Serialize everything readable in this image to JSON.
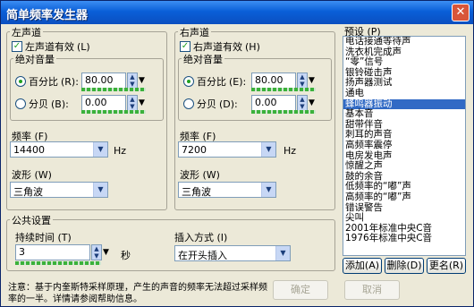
{
  "window": {
    "title": "简单频率发生器",
    "close_icon": "close-icon"
  },
  "left": {
    "group_title": "左声道",
    "enable_label": "左声道有效",
    "enable_shortcut": "(L)",
    "volume_title": "绝对音量",
    "percent_label": "百分比",
    "percent_shortcut": "(R):",
    "percent_value": "80.00",
    "db_label": "分贝",
    "db_shortcut": "(B):",
    "db_value": "0.00",
    "freq_label": "频率 (F)",
    "freq_value": "14400",
    "freq_unit": "Hz",
    "wave_label": "波形 (W)",
    "wave_value": "三角波"
  },
  "right": {
    "group_title": "右声道",
    "enable_label": "右声道有效",
    "enable_shortcut": "(H)",
    "volume_title": "绝对音量",
    "percent_label": "百分比",
    "percent_shortcut": "(E):",
    "percent_value": "80.00",
    "db_label": "分贝",
    "db_shortcut": "(D):",
    "db_value": "0.00",
    "freq_label": "频率 (F)",
    "freq_value": "7200",
    "freq_unit": "Hz",
    "wave_label": "波形 (W)",
    "wave_value": "三角波"
  },
  "common": {
    "group_title": "公共设置",
    "duration_label": "持续时间 (T)",
    "duration_value": "3",
    "duration_unit": "秒",
    "insert_label": "插入方式 (I)",
    "insert_value": "在开头插入"
  },
  "presets": {
    "title": "预设 (P)",
    "items": [
      "电话接通等待声",
      "洗衣机完成声",
      "“零”信号",
      "银铃碰击声",
      "扬声器测试",
      "通电",
      "蜂鸣器振动",
      "基本音",
      "甜带伴音",
      "刺耳的声音",
      "高频率震停",
      "电房发电声",
      "惊醒之声",
      "鼓的余音",
      "低频率的“嘟”声",
      "高频率的“嘟”声",
      "错误警告",
      "尖叫",
      "2001年标准中央C音",
      "1976年标准中央C音"
    ],
    "selected_index": 6,
    "add_label": "添加(A)",
    "delete_label": "删除(D)",
    "rename_label": "更名(R)"
  },
  "note": "注意：基于内奎斯特采样原理，产生的声音的频率无法超过采样频率的一半。详情请参阅帮助信息。",
  "ok_label": "确定",
  "cancel_label": "取消"
}
